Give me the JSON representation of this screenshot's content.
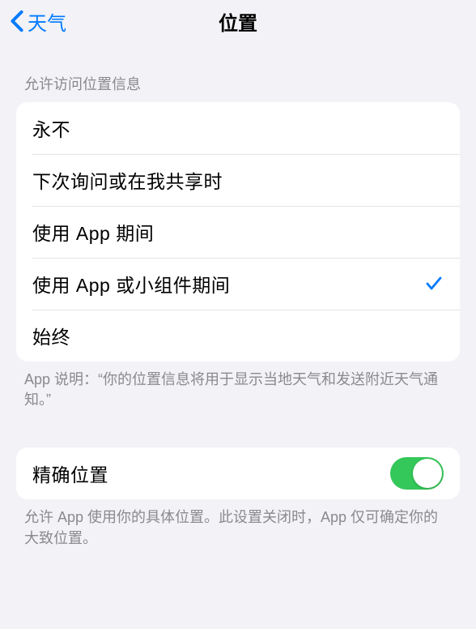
{
  "nav": {
    "back_label": "天气",
    "title": "位置"
  },
  "section1": {
    "header": "允许访问位置信息",
    "options": [
      {
        "label": "永不",
        "selected": false
      },
      {
        "label": "下次询问或在我共享时",
        "selected": false
      },
      {
        "label": "使用 App 期间",
        "selected": false
      },
      {
        "label": "使用 App 或小组件期间",
        "selected": true
      },
      {
        "label": "始终",
        "selected": false
      }
    ],
    "footer": "App 说明：“你的位置信息将用于显示当地天气和发送附近天气通知。”"
  },
  "section2": {
    "precise_label": "精确位置",
    "precise_on": true,
    "footer": "允许 App 使用你的具体位置。此设置关闭时，App 仅可确定你的大致位置。"
  }
}
